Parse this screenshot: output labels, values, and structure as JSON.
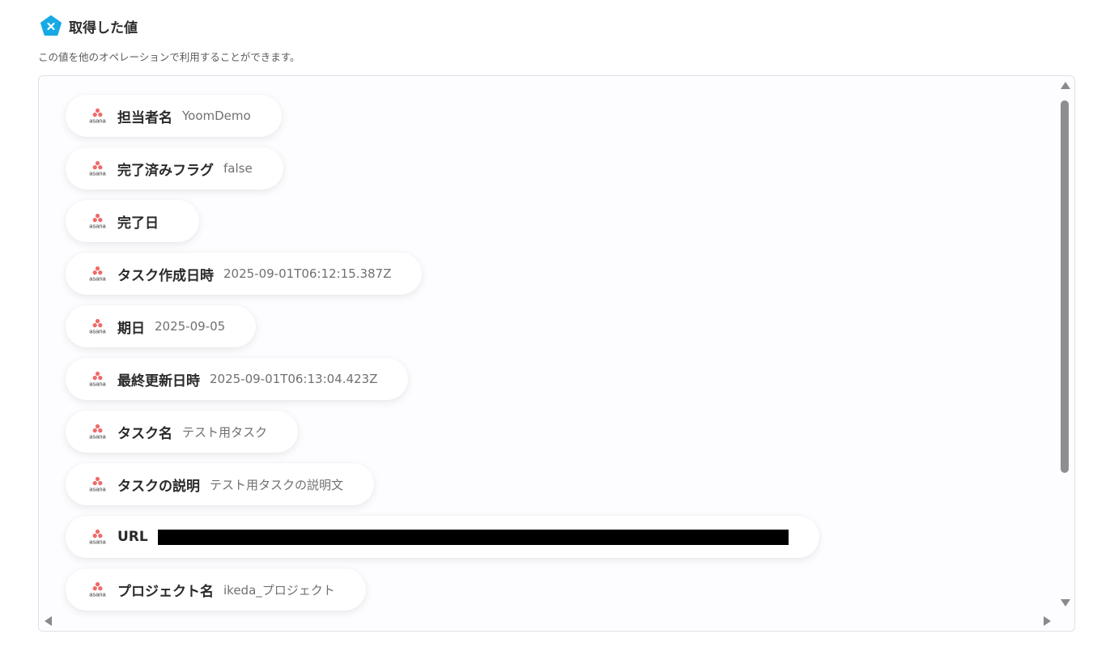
{
  "header": {
    "title": "取得した値",
    "description": "この値を他のオペレーションで利用することができます。",
    "icon": "yoom-pentagon-icon",
    "icon_color": "#16a9e6"
  },
  "source_logo": {
    "icon": "asana-logo-icon",
    "text": "asana",
    "color": "#f06a6a"
  },
  "items": [
    {
      "label": "担当者名",
      "value": "YoomDemo"
    },
    {
      "label": "完了済みフラグ",
      "value": "false"
    },
    {
      "label": "完了日",
      "value": ""
    },
    {
      "label": "タスク作成日時",
      "value": "2025-09-01T06:12:15.387Z"
    },
    {
      "label": "期日",
      "value": "2025-09-05"
    },
    {
      "label": "最終更新日時",
      "value": "2025-09-01T06:13:04.423Z"
    },
    {
      "label": "タスク名",
      "value": "テスト用タスク"
    },
    {
      "label": "タスクの説明",
      "value": "テスト用タスクの説明文"
    },
    {
      "label": "URL",
      "value": "",
      "redacted": true
    },
    {
      "label": "プロジェクト名",
      "value": "ikeda_プロジェクト"
    }
  ]
}
